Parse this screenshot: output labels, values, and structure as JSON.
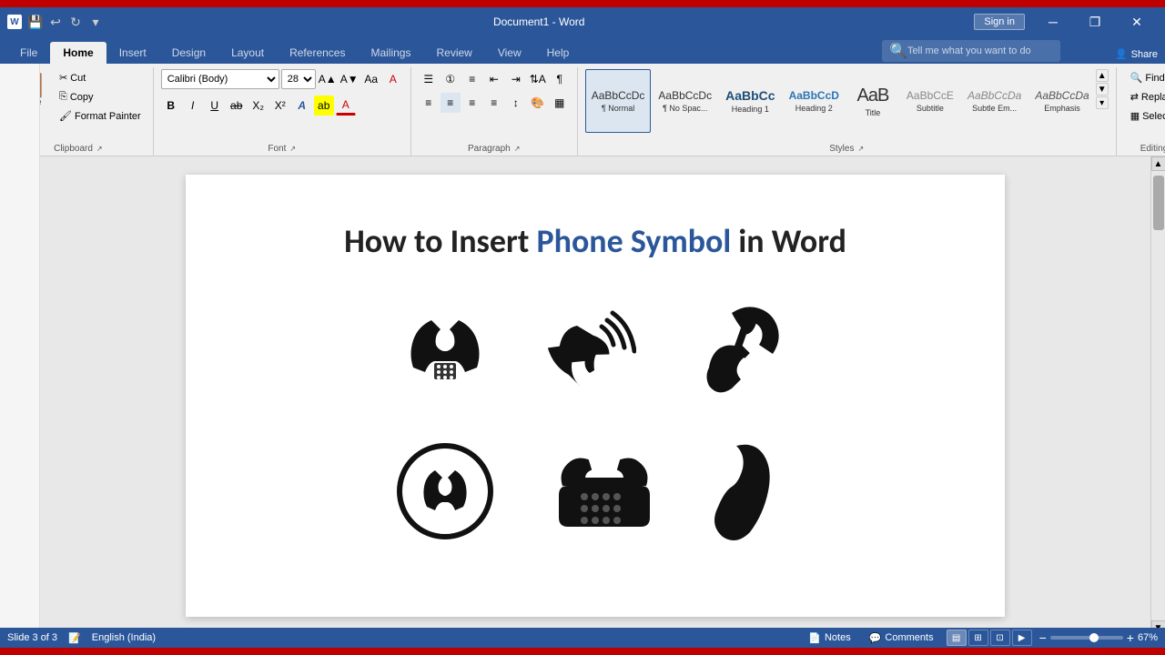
{
  "app": {
    "title": "Document1 - Word",
    "red_bar": true
  },
  "title_bar": {
    "title": "Document1 - Word",
    "signin_label": "Sign in",
    "share_label": "Share"
  },
  "ribbon": {
    "tabs": [
      {
        "id": "file",
        "label": "File"
      },
      {
        "id": "home",
        "label": "Home",
        "active": true
      },
      {
        "id": "insert",
        "label": "Insert"
      },
      {
        "id": "design",
        "label": "Design"
      },
      {
        "id": "layout",
        "label": "Layout"
      },
      {
        "id": "references",
        "label": "References"
      },
      {
        "id": "mailings",
        "label": "Mailings"
      },
      {
        "id": "review",
        "label": "Review"
      },
      {
        "id": "view",
        "label": "View"
      },
      {
        "id": "help",
        "label": "Help"
      }
    ],
    "search_placeholder": "Tell me what you want to do",
    "clipboard": {
      "label": "Clipboard",
      "paste_label": "Paste",
      "cut_label": "Cut",
      "copy_label": "Copy",
      "format_painter_label": "Format Painter"
    },
    "font": {
      "label": "Font",
      "font_name": "Calibri (Body)",
      "font_size": "28",
      "bold": "B",
      "italic": "I",
      "underline": "U"
    },
    "paragraph": {
      "label": "Paragraph"
    },
    "styles": {
      "label": "Styles",
      "items": [
        {
          "id": "normal",
          "preview": "AaBbCcDc",
          "label": "Normal",
          "selected": true
        },
        {
          "id": "no-space",
          "preview": "AaBbCcDc",
          "label": "No Spac..."
        },
        {
          "id": "heading1",
          "preview": "AaBbCc",
          "label": "Heading 1"
        },
        {
          "id": "heading2",
          "preview": "AaBbCcD",
          "label": "Heading 2"
        },
        {
          "id": "title",
          "preview": "AaB",
          "label": "Title"
        },
        {
          "id": "subtitle",
          "preview": "AaBbCcE",
          "label": "Subtitle"
        },
        {
          "id": "subtle-em",
          "preview": "AaBbCcDa",
          "label": "Subtle Em..."
        },
        {
          "id": "emphasis",
          "preview": "AaBbCcDa",
          "label": "Emphasis"
        }
      ]
    },
    "editing": {
      "label": "Editing",
      "find_label": "Find",
      "replace_label": "Replace",
      "select_label": "Select"
    }
  },
  "document": {
    "title_part1": "How to Insert ",
    "title_part2": "Phone Symbol",
    "title_part3": " in Word"
  },
  "status_bar": {
    "slide_info": "Slide 3 of 3",
    "language": "English (India)",
    "notes_label": "Notes",
    "comments_label": "Comments",
    "zoom_level": "67%"
  }
}
